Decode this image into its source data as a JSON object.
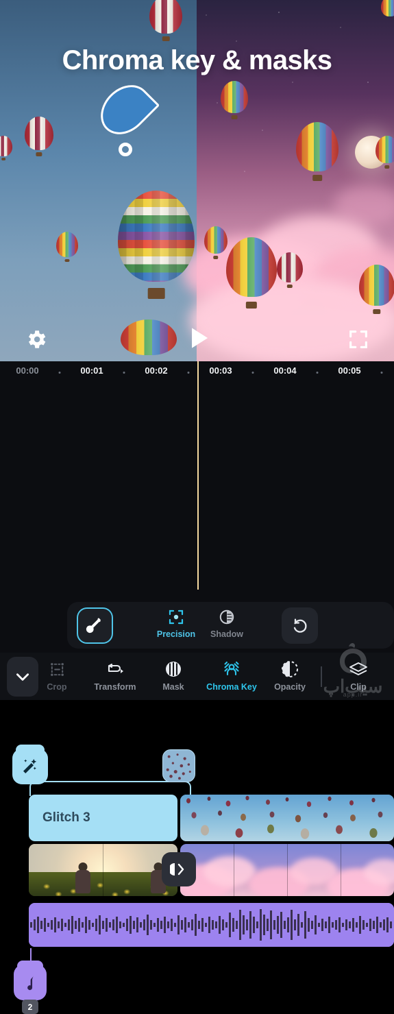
{
  "preview": {
    "title": "Chroma key & masks",
    "picker_cursor": "chroma-key-picker-pin",
    "controls": {
      "settings": "gear-icon",
      "play": "play-icon",
      "fullscreen": "fullscreen-icon"
    }
  },
  "timeline": {
    "ruler_labels": [
      "00:00",
      "00:01",
      "00:02",
      "00:03",
      "00:04",
      "00:05"
    ],
    "playhead_time": "00:03",
    "effect_track": {
      "tab_icon": "magic-wand-icon",
      "clip_label": "Glitch 3"
    },
    "video_track": {
      "transition_icon": "transition-icon"
    },
    "audio_track": {
      "tab_icon": "music-note-icon",
      "badge": "2"
    }
  },
  "subtoolbar": {
    "picker": "eyedropper-icon",
    "items": [
      {
        "label": "Precision",
        "icon": "precision-icon",
        "active": true
      },
      {
        "label": "Shadow",
        "icon": "shadow-icon",
        "active": false
      }
    ],
    "reset": "reset-icon"
  },
  "bottombar": {
    "collapse": "chevron-down-icon",
    "tools": [
      {
        "label": "Crop",
        "icon": "crop-icon",
        "state": "disabled"
      },
      {
        "label": "Transform",
        "icon": "transform-icon",
        "state": "normal"
      },
      {
        "label": "Mask",
        "icon": "mask-icon",
        "state": "normal"
      },
      {
        "label": "Chroma Key",
        "icon": "chroma-key-icon",
        "state": "active"
      },
      {
        "label": "Opacity",
        "icon": "opacity-icon",
        "state": "normal"
      },
      {
        "label": "Clip",
        "icon": "clip-icon",
        "state": "normal"
      }
    ]
  },
  "watermark": {
    "text": "سیب‌اپ",
    "sub": "app.ir"
  },
  "colors": {
    "accent": "#2ec5ec",
    "effect_clip": "#a5dff5",
    "audio_clip": "#9d83ef",
    "playhead": "#f5d9a0",
    "background": "#0c0d11"
  }
}
